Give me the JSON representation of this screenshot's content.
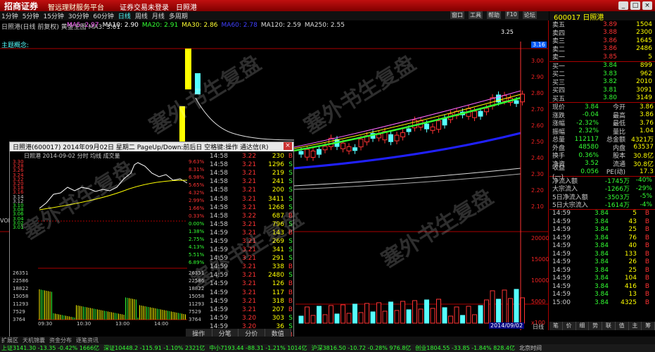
{
  "app": {
    "logo": "招商证券",
    "slogan": "智远理财服务平台",
    "menu": [
      "证券交易未登录",
      "日照港"
    ]
  },
  "toolbar_right": [
    "窗口",
    "工具",
    "帮助",
    "F10",
    "论坛"
  ],
  "periods": [
    "1分钟",
    "5分钟",
    "15分钟",
    "30分钟",
    "60分钟",
    "日线",
    "周线",
    "月线",
    "多周期"
  ],
  "selected_period": "日线",
  "header_info": "日照港(日线 前复权) 黄金主图 MA3: 3.01",
  "ma_legend": [
    {
      "label": "MA5: 2.97",
      "color": "#ff66ff"
    },
    {
      "label": "MA10: 2.90",
      "color": "#ffffff"
    },
    {
      "label": "MA20: 2.91",
      "color": "#33ff33"
    },
    {
      "label": "MA30: 2.86",
      "color": "#ffff33"
    },
    {
      "label": "MA60: 2.78",
      "color": "#4040ff"
    },
    {
      "label": "MA120: 2.59",
      "color": "#dddddd"
    },
    {
      "label": "MA250: 2.55",
      "color": "#dddddd"
    }
  ],
  "themes_label": "主题概念:",
  "high_label": "3.25",
  "price_axis": [
    "3.16",
    "3.00",
    "2.90",
    "2.80",
    "2.70",
    "2.60",
    "2.50",
    "2.40",
    "2.30",
    "2.20",
    "2.10"
  ],
  "vol_axis": [
    "20000",
    "15000",
    "10000",
    "5000",
    "x100"
  ],
  "date_label": "2014/09/02",
  "vol_label": "VOL",
  "indicator_tab": "日线",
  "watermark": "塞外书生复盘",
  "quote": {
    "code_name": "600017 日照港",
    "asks": [
      {
        "label": "卖五",
        "price": "3.89",
        "vol": "1504"
      },
      {
        "label": "卖四",
        "price": "3.88",
        "vol": "2300"
      },
      {
        "label": "卖三",
        "price": "3.86",
        "vol": "1645"
      },
      {
        "label": "卖二",
        "price": "3.86",
        "vol": "2486"
      },
      {
        "label": "卖一",
        "price": "3.85",
        "vol": "5"
      }
    ],
    "bids": [
      {
        "label": "买一",
        "price": "3.84",
        "vol": "899"
      },
      {
        "label": "买二",
        "price": "3.83",
        "vol": "962"
      },
      {
        "label": "买三",
        "price": "3.82",
        "vol": "2010"
      },
      {
        "label": "买四",
        "price": "3.81",
        "vol": "3091"
      },
      {
        "label": "买五",
        "price": "3.80",
        "vol": "3149"
      }
    ],
    "stats": [
      {
        "l1": "现价",
        "v1": "3.84",
        "l2": "今开",
        "v2": "3.86"
      },
      {
        "l1": "涨跌",
        "v1": "-0.04",
        "l2": "最高",
        "v2": "3.86"
      },
      {
        "l1": "涨幅",
        "v1": "-2.32%",
        "l2": "最低",
        "v2": "3.76"
      },
      {
        "l1": "振幅",
        "v1": "2.32%",
        "l2": "量比",
        "v2": "1.04"
      },
      {
        "l1": "总量",
        "v1": "112117",
        "l2": "总金额",
        "v2": "4321万"
      },
      {
        "l1": "外盘",
        "v1": "48580",
        "l2": "内盘",
        "v2": "63537"
      },
      {
        "l1": "换手",
        "v1": "0.36%",
        "l2": "股本",
        "v2": "30.8亿"
      },
      {
        "l1": "净资",
        "v1": "3.52",
        "l2": "流通",
        "v2": "30.8亿"
      },
      {
        "l1": "收益(一)",
        "v1": "0.056",
        "l2": "PE(动)",
        "v2": "17.3"
      }
    ],
    "flows": [
      {
        "label": "净流入额",
        "val": "-1745万",
        "pct": "-40%"
      },
      {
        "label": "大宗流入",
        "val": "-1266万",
        "pct": "-29%"
      },
      {
        "label": "5日净流入额",
        "val": "-3503万",
        "pct": "-5%"
      },
      {
        "label": "5日大宗流入",
        "val": "-1614万",
        "pct": "-4%"
      }
    ],
    "ticks": [
      {
        "t": "14:59",
        "p": "3.84",
        "v": "5",
        "d": "B"
      },
      {
        "t": "14:59",
        "p": "3.84",
        "v": "43",
        "d": "B"
      },
      {
        "t": "14:59",
        "p": "3.84",
        "v": "25",
        "d": "B"
      },
      {
        "t": "14:59",
        "p": "3.84",
        "v": "76",
        "d": "B"
      },
      {
        "t": "14:59",
        "p": "3.84",
        "v": "40",
        "d": "B"
      },
      {
        "t": "14:59",
        "p": "3.84",
        "v": "133",
        "d": "B"
      },
      {
        "t": "14:59",
        "p": "3.84",
        "v": "26",
        "d": "B"
      },
      {
        "t": "14:59",
        "p": "3.84",
        "v": "25",
        "d": "B"
      },
      {
        "t": "14:59",
        "p": "3.84",
        "v": "104",
        "d": "B"
      },
      {
        "t": "14:59",
        "p": "3.84",
        "v": "416",
        "d": "B"
      },
      {
        "t": "14:59",
        "p": "3.84",
        "v": "13",
        "d": "B"
      },
      {
        "t": "15:00",
        "p": "3.84",
        "v": "4325",
        "d": "B"
      }
    ],
    "tabs": [
      "笔",
      "价",
      "细",
      "势",
      "联",
      "值",
      "主",
      "筹"
    ]
  },
  "popup": {
    "title": "日照港(600017) 2014年09月02日 星期二 PageUp/Down:前后日 空格键:操作 通达信(R)",
    "header": "日照港  2014-09-02 分时 均线 成交量",
    "price_labels": [
      "3.30",
      "3.28",
      "3.26",
      "3.24",
      "3.22",
      "3.20",
      "3.18",
      "3.16",
      "3.14",
      "3.12",
      "3.10",
      "3.08",
      "3.06",
      "3.04",
      "3.02",
      "3.01"
    ],
    "pct_labels": [
      "9.63%",
      "8.31%",
      "6.98%",
      "5.65%",
      "4.32%",
      "2.99%",
      "1.66%",
      "0.33%",
      "0.00%",
      "1.38%",
      "2.75%",
      "4.13%",
      "5.51%",
      "6.89%"
    ],
    "vol_labels": [
      "26351",
      "22586",
      "18822",
      "15058",
      "11293",
      "7529",
      "3764"
    ],
    "time_labels": [
      "09:30",
      "10:30",
      "13:00",
      "14:00"
    ],
    "tabs": [
      "操作",
      "分笔",
      "分价",
      "数值"
    ],
    "trades": [
      {
        "t": "14:58",
        "p": "3.22",
        "v": "230",
        "d": "B"
      },
      {
        "t": "14:58",
        "p": "3.21",
        "v": "1296",
        "d": "S"
      },
      {
        "t": "14:58",
        "p": "3.21",
        "v": "219",
        "d": "S"
      },
      {
        "t": "14:58",
        "p": "3.21",
        "v": "241",
        "d": "S"
      },
      {
        "t": "14:58",
        "p": "3.21",
        "v": "200",
        "d": "S"
      },
      {
        "t": "14:58",
        "p": "3.21",
        "v": "3411",
        "d": "S"
      },
      {
        "t": "14:58",
        "p": "3.21",
        "v": "1268",
        "d": "S"
      },
      {
        "t": "14:58",
        "p": "3.22",
        "v": "687",
        "d": "B"
      },
      {
        "t": "14:58",
        "p": "3.21",
        "v": "796",
        "d": "S"
      },
      {
        "t": "14:59",
        "p": "3.21",
        "v": "143",
        "d": "B"
      },
      {
        "t": "14:59",
        "p": "3.21",
        "v": "269",
        "d": "S"
      },
      {
        "t": "14:59",
        "p": "3.21",
        "v": "341",
        "d": "S"
      },
      {
        "t": "14:59",
        "p": "3.21",
        "v": "291",
        "d": "S"
      },
      {
        "t": "14:59",
        "p": "3.21",
        "v": "338",
        "d": "B"
      },
      {
        "t": "14:59",
        "p": "3.21",
        "v": "2480",
        "d": "S"
      },
      {
        "t": "14:59",
        "p": "3.21",
        "v": "126",
        "d": "B"
      },
      {
        "t": "14:59",
        "p": "3.21",
        "v": "117",
        "d": "B"
      },
      {
        "t": "14:59",
        "p": "3.21",
        "v": "318",
        "d": "B"
      },
      {
        "t": "14:59",
        "p": "3.21",
        "v": "207",
        "d": "B"
      },
      {
        "t": "14:59",
        "p": "3.20",
        "v": "303",
        "d": "S"
      },
      {
        "t": "14:59",
        "p": "3.20",
        "v": "36",
        "d": "S"
      },
      {
        "t": "15:00",
        "p": "3.21",
        "v": "329",
        "d": "B"
      }
    ]
  },
  "statusbar": [
    "扩展区",
    "天机锦囊",
    "资金分布",
    "逐笔资讯"
  ],
  "indexbar": [
    {
      "text": "上证3141.30 -13.35 -0.42% 1666亿",
      "color": "#3f3"
    },
    {
      "text": "深证10448.2 -115.91 -1.10% 2321亿",
      "color": "#3f3"
    },
    {
      "text": "中小7193.44 -88.31 -1.21% 1014亿",
      "color": "#3f3"
    },
    {
      "text": "沪深3816.50 -10.72 -0.28% 976.8亿",
      "color": "#3f3"
    },
    {
      "text": "创业1804.55 -33.85 -1.84% 828.4亿",
      "color": "#3f3"
    },
    {
      "text": "北京时间",
      "color": "#ccc"
    }
  ]
}
